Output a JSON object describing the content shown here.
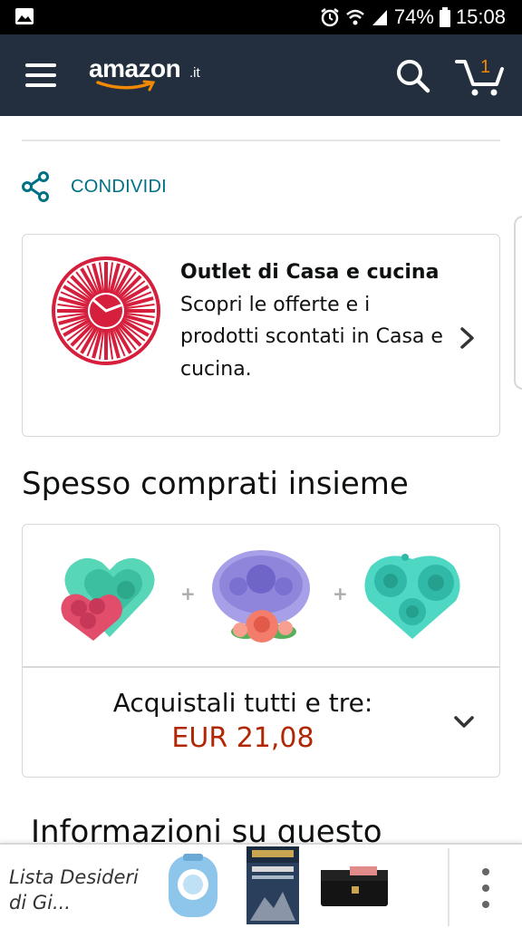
{
  "status_bar": {
    "battery": "74%",
    "time": "15:08",
    "icons": [
      "image-icon",
      "alarm-icon",
      "wifi-icon",
      "signal-icon",
      "battery-icon"
    ]
  },
  "header": {
    "logo_text": "amazon",
    "logo_tld": ".it",
    "cart_count": "1",
    "colors": {
      "background": "#232f3e",
      "accent": "#f08804"
    }
  },
  "share": {
    "label": "CONDIVIDI"
  },
  "outlet": {
    "title": "Outlet di Casa e cucina",
    "description": "Scopri le offerte e i prodotti scontati in Casa e cucina."
  },
  "frequently_bought": {
    "heading": "Spesso comprati insieme",
    "buy_all_label": "Acquistali tutti e tre:",
    "price": "EUR 21,08",
    "products": [
      "heart-rose-mold",
      "oval-roses-mold",
      "three-roses-mold"
    ],
    "price_color": "#b12704"
  },
  "info": {
    "heading": "Informazioni su questo"
  },
  "wishlist_bar": {
    "label": "Lista Desideri di Gi..."
  },
  "link_color": "#007185"
}
